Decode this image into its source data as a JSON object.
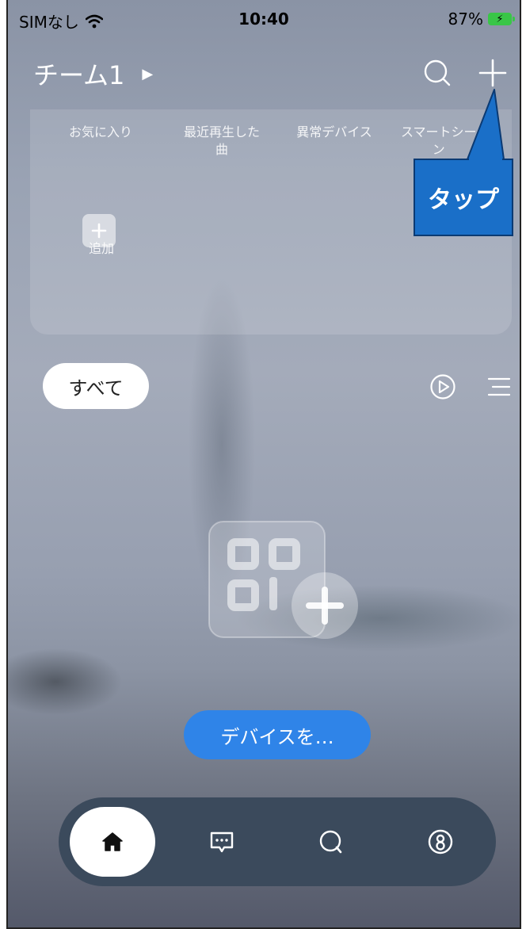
{
  "status_bar": {
    "carrier": "SIMなし",
    "time": "10:40",
    "battery": "87%"
  },
  "header": {
    "team_name": "チーム1",
    "icons": [
      "play-triangle-icon",
      "search-icon",
      "plus-icon"
    ]
  },
  "favorites": {
    "tabs": [
      "お気に入り",
      "最近再生した\n曲",
      "異常デバイス",
      "スマートシー\nン"
    ],
    "add_label": "追加"
  },
  "callout": {
    "text": "タップ"
  },
  "filter": {
    "pill_label": "すべて",
    "icons": [
      "play-circle-icon",
      "menu-icon"
    ]
  },
  "empty_state": {
    "icon": "add-device-icon",
    "button_label": "デバイスを…"
  },
  "bottom_nav": {
    "items": [
      {
        "icon": "home-icon",
        "active": true
      },
      {
        "icon": "message-icon",
        "active": false
      },
      {
        "icon": "discover-icon",
        "active": false
      },
      {
        "icon": "profile-icon",
        "active": false
      }
    ]
  },
  "colors": {
    "accent": "#2f84e8",
    "callout": "#1a6fc8",
    "nav_bar": "#3b4a5c",
    "battery": "#39c647"
  }
}
